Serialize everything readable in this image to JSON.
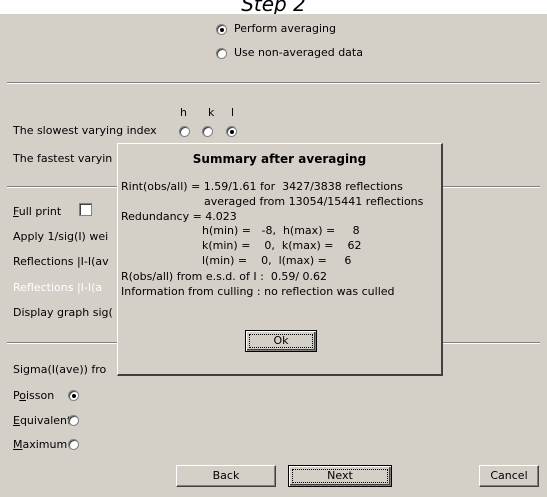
{
  "step_title": "Step 2",
  "averaging": {
    "perform_label": "Perform averaging",
    "non_averaged_label": "Use non-averaged data",
    "selected": "perform"
  },
  "index": {
    "col_h": "h",
    "col_k": "k",
    "col_l": "l",
    "slowest_label": "The slowest varying index",
    "fastest_label": "The fastest varyin",
    "slowest_selected": "l"
  },
  "options": {
    "full_print_label": "Full print",
    "apply_weights_label": "Apply 1/sig(I) wei",
    "reflections_label": "Reflections |I-I(av",
    "reflections_white_label": "Reflections |I-I(a",
    "display_graph_label": "Display graph sig("
  },
  "sigma": {
    "header": "Sigma(I(ave)) fro",
    "poisson_label": "Poisson",
    "equivalents_label": "Equivalents",
    "maximum_label": "Maximum",
    "selected": "poisson"
  },
  "buttons": {
    "back": "Back",
    "next": "Next",
    "cancel": "Cancel"
  },
  "dialog": {
    "title": "Summary after averaging",
    "lines": [
      "Rint(obs/all) = 1.59/1.61 for  3427/3838 reflections",
      "averaged from 13054/15441 reflections",
      "Redundancy = 4.023",
      "h(min) =   -8,  h(max) =     8",
      "k(min) =    0,  k(max) =    62",
      "l(min) =    0,  l(max) =     6",
      "R(obs/all) from e.s.d. of I :  0.59/ 0.62",
      "Information from culling : no reflection was culled"
    ],
    "ok_label": "Ok"
  }
}
